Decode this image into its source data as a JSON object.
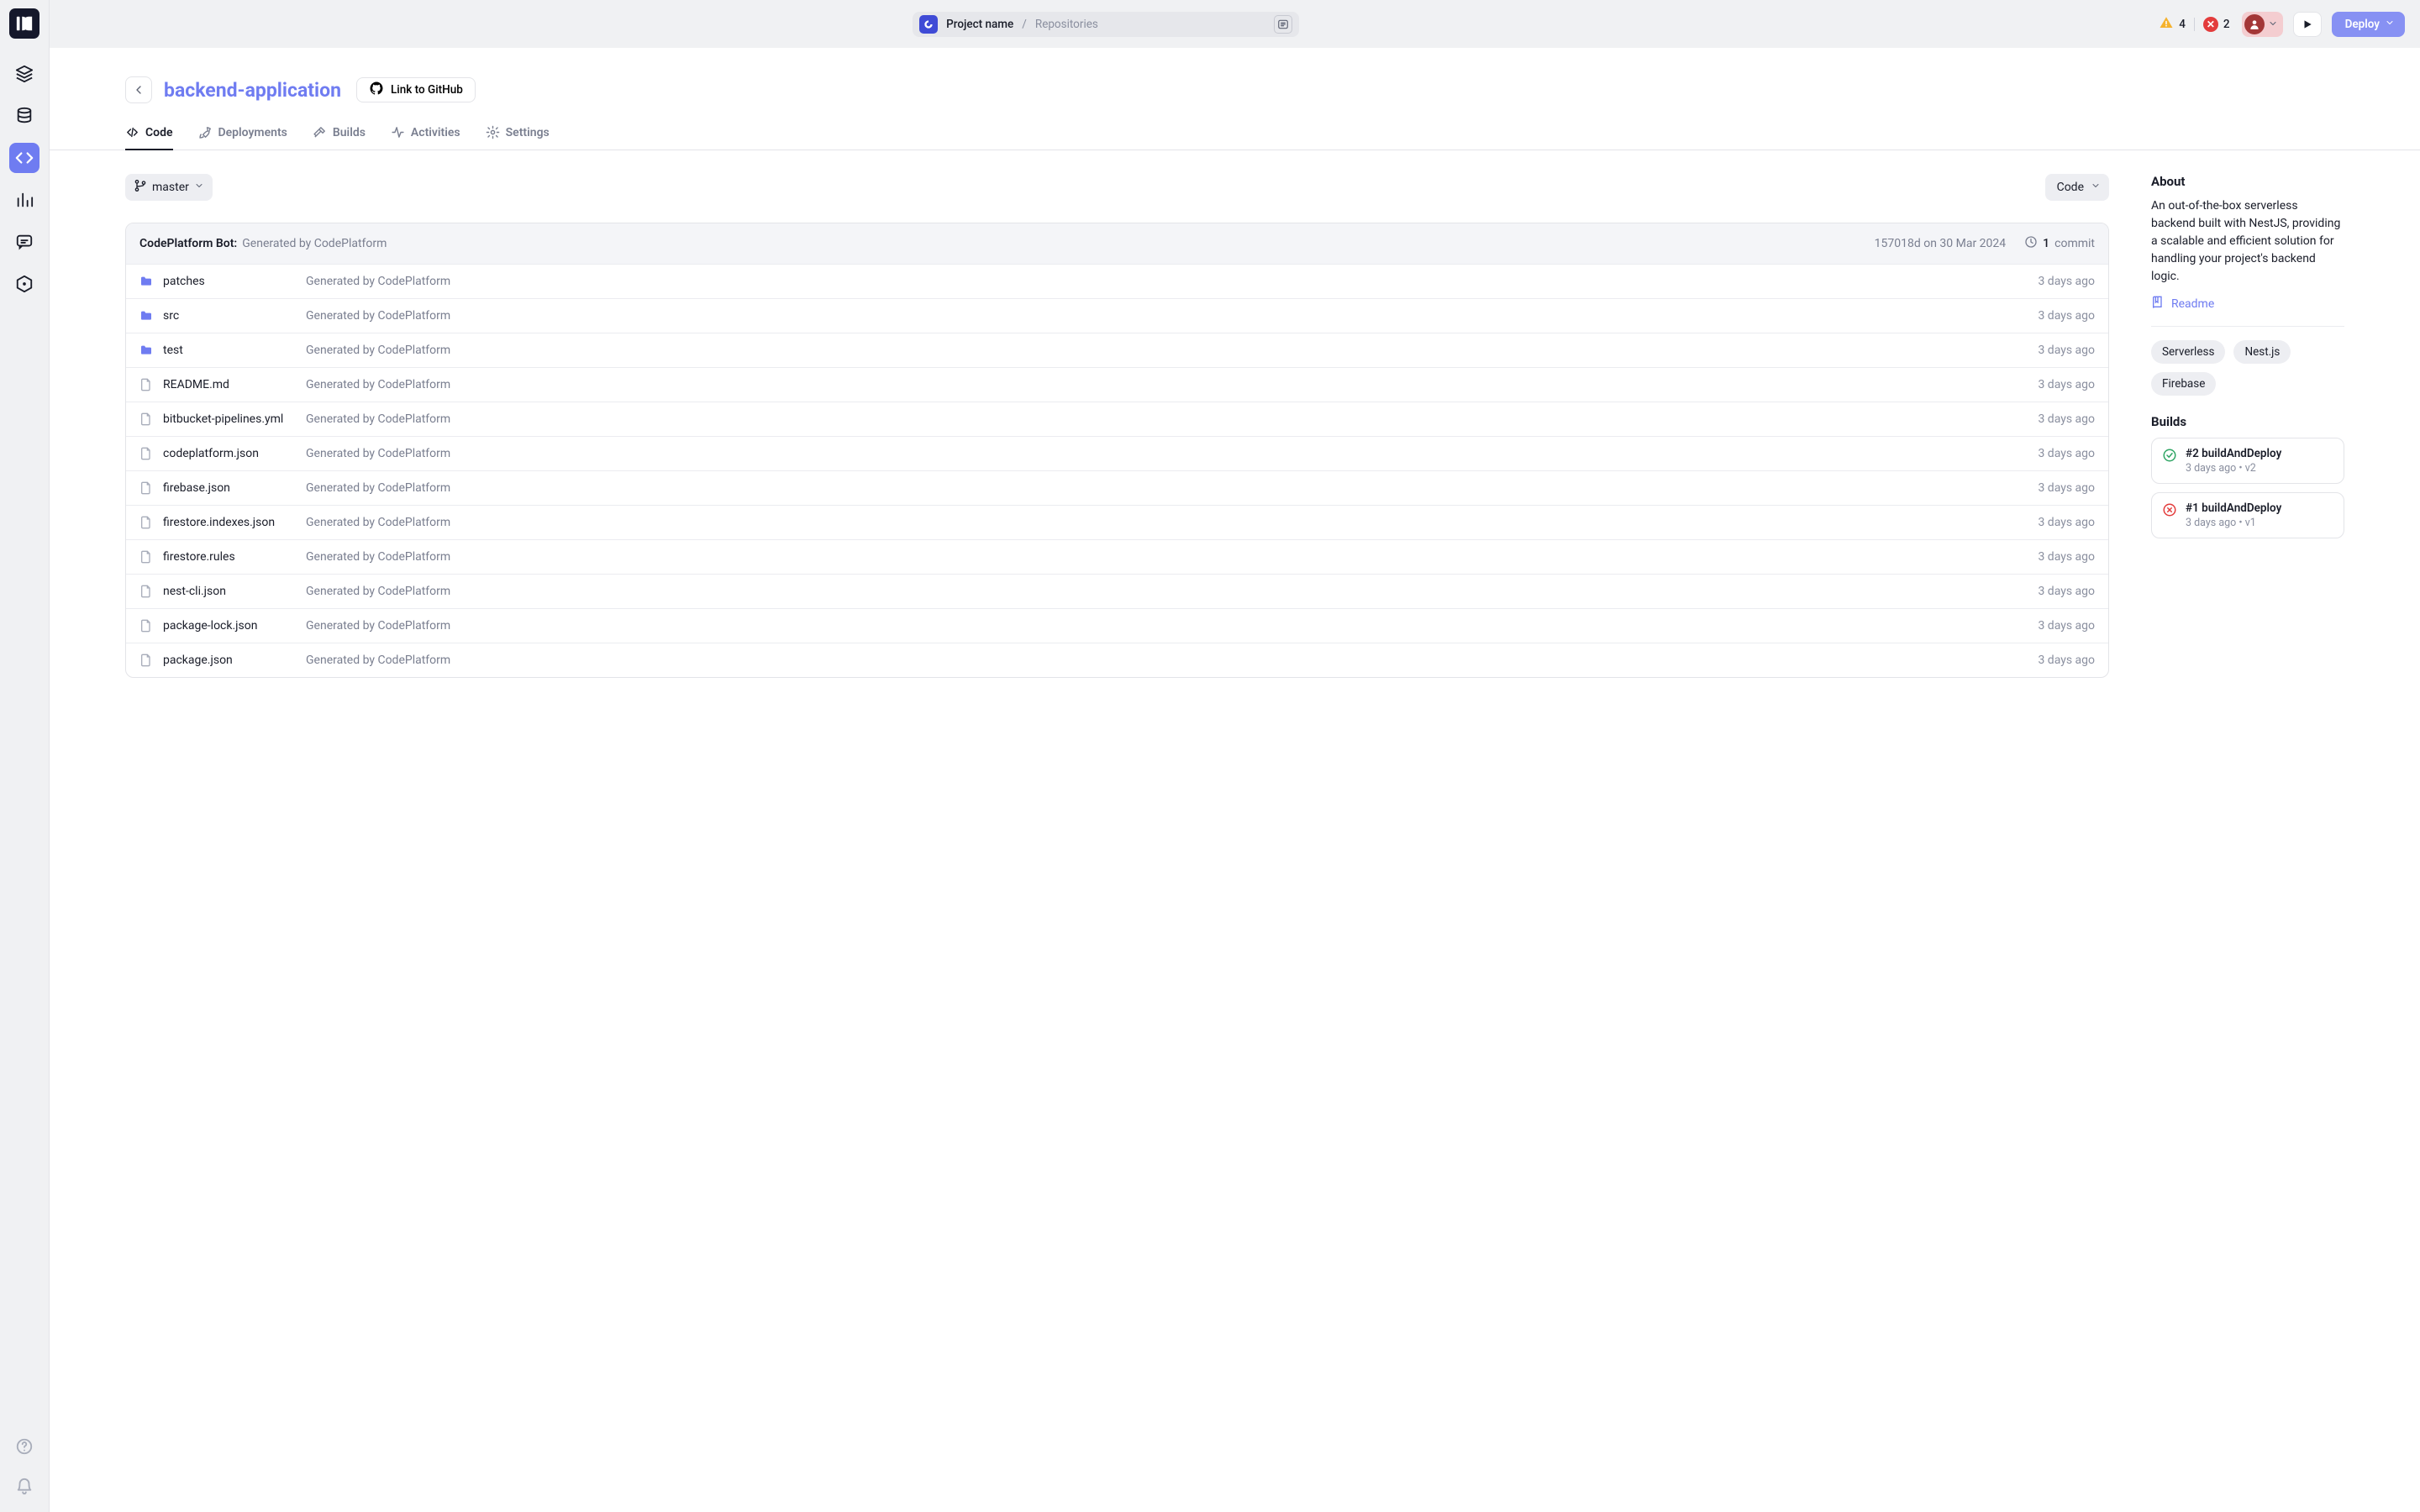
{
  "breadcrumb": {
    "project": "Project name",
    "page": "Repositories"
  },
  "status": {
    "warnings": "4",
    "errors": "2"
  },
  "deploy_label": "Deploy",
  "page": {
    "title": "backend-application",
    "github_link": "Link to GitHub"
  },
  "subtabs": {
    "code": "Code",
    "deployments": "Deployments",
    "builds": "Builds",
    "activities": "Activities",
    "settings": "Settings"
  },
  "toolbar": {
    "branch": "master",
    "code_dd": "Code"
  },
  "commit_bar": {
    "author": "CodePlatform Bot:",
    "message": "Generated by CodePlatform",
    "hash_date": "157018d on 30 Mar 2024",
    "count": "1",
    "commit_word": "commit"
  },
  "files": [
    {
      "type": "folder",
      "name": "patches",
      "msg": "Generated by CodePlatform",
      "when": "3 days ago"
    },
    {
      "type": "folder",
      "name": "src",
      "msg": "Generated by CodePlatform",
      "when": "3 days ago"
    },
    {
      "type": "folder",
      "name": "test",
      "msg": "Generated by CodePlatform",
      "when": "3 days ago"
    },
    {
      "type": "file",
      "name": "README.md",
      "msg": "Generated by CodePlatform",
      "when": "3 days ago"
    },
    {
      "type": "file",
      "name": "bitbucket-pipelines.yml",
      "msg": "Generated by CodePlatform",
      "when": "3 days ago"
    },
    {
      "type": "file",
      "name": "codeplatform.json",
      "msg": "Generated by CodePlatform",
      "when": "3 days ago"
    },
    {
      "type": "file",
      "name": "firebase.json",
      "msg": "Generated by CodePlatform",
      "when": "3 days ago"
    },
    {
      "type": "file",
      "name": "firestore.indexes.json",
      "msg": "Generated by CodePlatform",
      "when": "3 days ago"
    },
    {
      "type": "file",
      "name": "firestore.rules",
      "msg": "Generated by CodePlatform",
      "when": "3 days ago"
    },
    {
      "type": "file",
      "name": "nest-cli.json",
      "msg": "Generated by CodePlatform",
      "when": "3 days ago"
    },
    {
      "type": "file",
      "name": "package-lock.json",
      "msg": "Generated by CodePlatform",
      "when": "3 days ago"
    },
    {
      "type": "file",
      "name": "package.json",
      "msg": "Generated by CodePlatform",
      "when": "3 days ago"
    }
  ],
  "about": {
    "heading": "About",
    "text": "An out-of-the-box serverless backend built with NestJS, providing a scalable and efficient solution for handling your project's backend logic.",
    "readme": "Readme",
    "tags": [
      "Serverless",
      "Nest.js",
      "Firebase"
    ]
  },
  "builds": {
    "heading": "Builds",
    "items": [
      {
        "status": "ok",
        "title": "#2 buildAndDeploy",
        "sub": "3 days ago  •  v2"
      },
      {
        "status": "fail",
        "title": "#1 buildAndDeploy",
        "sub": "3 days ago  •  v1"
      }
    ]
  }
}
